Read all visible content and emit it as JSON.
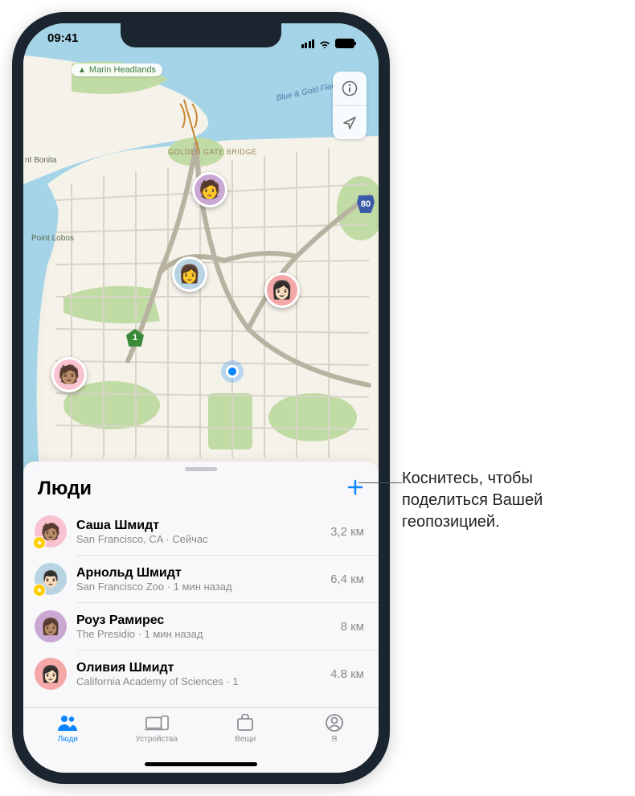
{
  "status": {
    "time": "09:41"
  },
  "map": {
    "labels": {
      "marin": "Marin Headlands",
      "bridge": "GOLDEN GATE\nBRIDGE",
      "bonita": "nt Bonita",
      "lobos": "Point Lobos",
      "water": "Blue & Gold Fleet",
      "hwy1": "1",
      "hwy80": "80"
    }
  },
  "sheet": {
    "title": "Люди"
  },
  "people": [
    {
      "name": "Саша Шмидт",
      "sub": "San Francisco, CA · Сейчас",
      "dist": "3,2 км",
      "avatar_bg": "#f9c2d1",
      "fav": true
    },
    {
      "name": "Арнольд Шмидт",
      "sub": "San Francisco Zoo · 1 мин назад",
      "dist": "6,4 км",
      "avatar_bg": "#b8d4e3",
      "fav": true
    },
    {
      "name": "Роуз Рамирес",
      "sub": "The Presidio · 1 мин назад",
      "dist": "8 км",
      "avatar_bg": "#c9a8d4",
      "fav": false
    },
    {
      "name": "Оливия Шмидт",
      "sub": "California Academy of Sciences · 1",
      "dist": "4.8 км",
      "avatar_bg": "#f4a8a8",
      "fav": false
    }
  ],
  "tabs": [
    {
      "label": "Люди",
      "active": true
    },
    {
      "label": "Устройства",
      "active": false
    },
    {
      "label": "Вещи",
      "active": false
    },
    {
      "label": "Я",
      "active": false
    }
  ],
  "callout": "Коснитесь, чтобы поделиться Вашей геопозицией."
}
